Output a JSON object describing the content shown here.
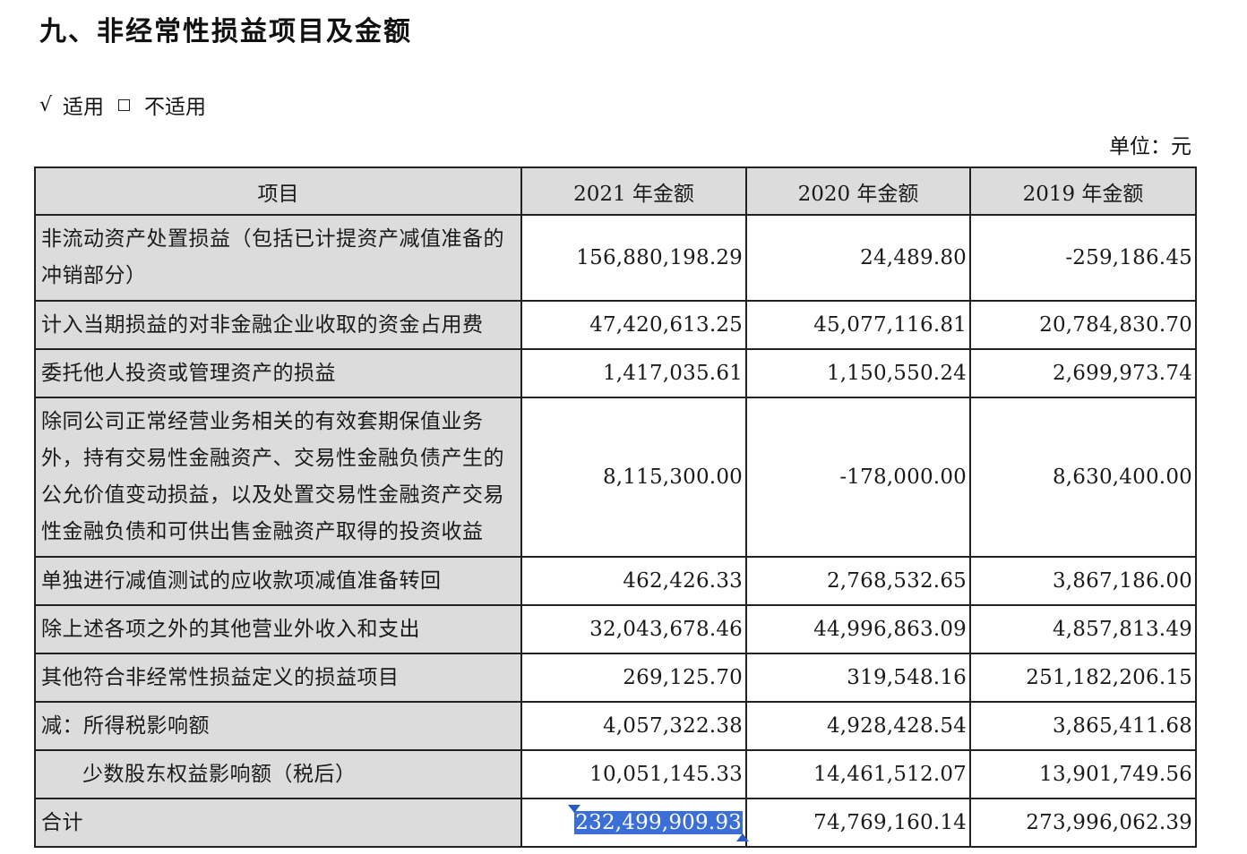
{
  "heading": "九、非经常性损益项目及金额",
  "applicable": {
    "check": "√",
    "applicable_label": "适用",
    "not_applicable_label": "不适用"
  },
  "unit": "单位：元",
  "table": {
    "headers": [
      "项目",
      "2021 年金额",
      "2020 年金额",
      "2019 年金额"
    ],
    "rows": [
      {
        "label": "非流动资产处置损益（包括已计提资产减值准备的冲销部分）",
        "v2021": "156,880,198.29",
        "v2020": "24,489.80",
        "v2019": "-259,186.45"
      },
      {
        "label": "计入当期损益的对非金融企业收取的资金占用费",
        "v2021": "47,420,613.25",
        "v2020": "45,077,116.81",
        "v2019": "20,784,830.70"
      },
      {
        "label": "委托他人投资或管理资产的损益",
        "v2021": "1,417,035.61",
        "v2020": "1,150,550.24",
        "v2019": "2,699,973.74"
      },
      {
        "label": "除同公司正常经营业务相关的有效套期保值业务外，持有交易性金融资产、交易性金融负债产生的公允价值变动损益，以及处置交易性金融资产交易性金融负债和可供出售金融资产取得的投资收益",
        "v2021": "8,115,300.00",
        "v2020": "-178,000.00",
        "v2019": "8,630,400.00"
      },
      {
        "label": "单独进行减值测试的应收款项减值准备转回",
        "v2021": "462,426.33",
        "v2020": "2,768,532.65",
        "v2019": "3,867,186.00"
      },
      {
        "label": "除上述各项之外的其他营业外收入和支出",
        "v2021": "32,043,678.46",
        "v2020": "44,996,863.09",
        "v2019": "4,857,813.49"
      },
      {
        "label": "其他符合非经常性损益定义的损益项目",
        "v2021": "269,125.70",
        "v2020": "319,548.16",
        "v2019": "251,182,206.15"
      },
      {
        "label": "减：所得税影响额",
        "v2021": "4,057,322.38",
        "v2020": "4,928,428.54",
        "v2019": "3,865,411.68"
      },
      {
        "label": "少数股东权益影响额（税后）",
        "v2021": "10,051,145.33",
        "v2020": "14,461,512.07",
        "v2019": "13,901,749.56"
      },
      {
        "label": "合计",
        "v2021": "232,499,909.93",
        "v2020": "74,769,160.14",
        "v2019": "273,996,062.39"
      }
    ]
  }
}
